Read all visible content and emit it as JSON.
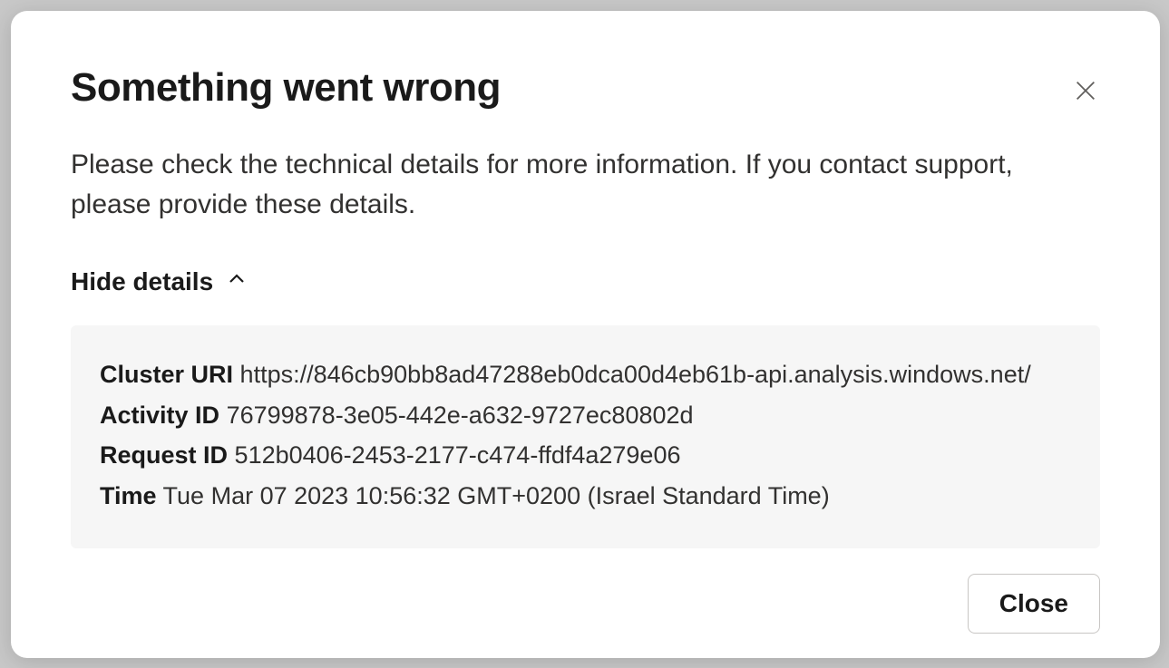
{
  "modal": {
    "title": "Something went wrong",
    "message": "Please check the technical details for more information. If you contact support, please provide these details.",
    "toggle_label": "Hide details",
    "details": {
      "cluster_uri_label": "Cluster URI",
      "cluster_uri_value": "https://846cb90bb8ad47288eb0dca00d4eb61b-api.analysis.windows.net/",
      "activity_id_label": "Activity ID",
      "activity_id_value": "76799878-3e05-442e-a632-9727ec80802d",
      "request_id_label": "Request ID",
      "request_id_value": "512b0406-2453-2177-c474-ffdf4a279e06",
      "time_label": "Time",
      "time_value": "Tue Mar 07 2023 10:56:32 GMT+0200 (Israel Standard Time)"
    },
    "close_label": "Close"
  }
}
